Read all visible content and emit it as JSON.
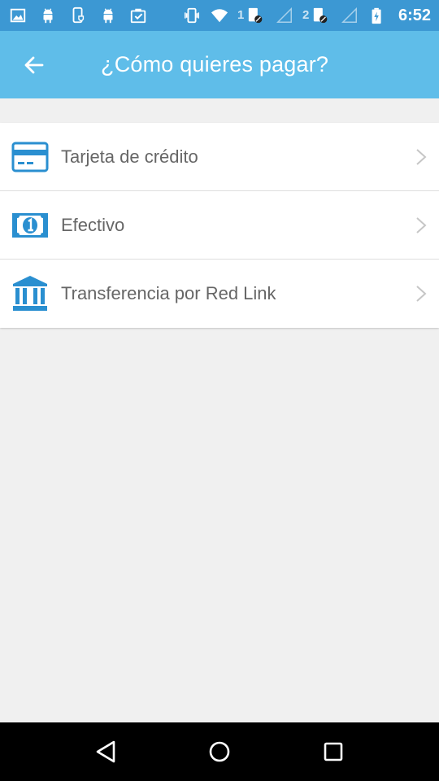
{
  "status_bar": {
    "time": "6:52",
    "sim1": "1",
    "sim2": "2",
    "icons": [
      "image-icon",
      "android-icon",
      "phone-shield-icon",
      "android-icon",
      "clipboard-check-icon",
      "vibrate-icon",
      "wifi-icon",
      "sim-signal-icon",
      "battery-charging-icon"
    ]
  },
  "app_bar": {
    "title": "¿Cómo quieres pagar?",
    "back_icon": "arrow-left-icon"
  },
  "payment_options": [
    {
      "icon": "credit-card-icon",
      "label": "Tarjeta de crédito"
    },
    {
      "icon": "cash-bill-icon",
      "label": "Efectivo"
    },
    {
      "icon": "bank-icon",
      "label": "Transferencia por Red Link"
    }
  ],
  "nav_bar": {
    "buttons": [
      "back-triangle-icon",
      "home-circle-icon",
      "recents-square-icon"
    ]
  },
  "colors": {
    "status_bar": "#3c98d3",
    "app_bar": "#5fbde9",
    "icon_blue": "#2a8fd0",
    "background": "#f0f0f0"
  }
}
